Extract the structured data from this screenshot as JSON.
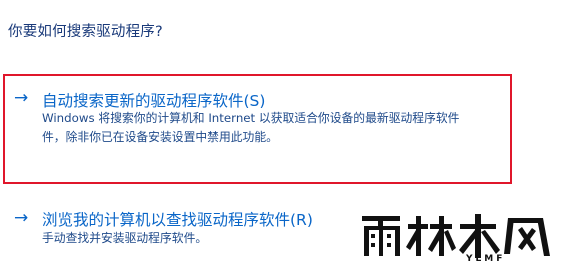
{
  "question": "你要如何搜索驱动程序?",
  "options": [
    {
      "arrow_icon": "arrow-right-icon",
      "title": "自动搜索更新的驱动程序软件(S)",
      "desc_line1": "Windows 将搜索你的计算机和 Internet 以获取适合你设备的最新驱动程序软件",
      "desc_line2": "件，除非你已在设备安装设置中禁用此功能。"
    },
    {
      "arrow_icon": "arrow-right-icon",
      "title": "浏览我的计算机以查找驱动程序软件(R)",
      "desc_line1": "手动查找并安装驱动程序软件。"
    }
  ],
  "highlight_color": "#e0162b",
  "accent_color": "#0a66c8",
  "watermark": {
    "text": "雨林木风",
    "sub": "YLMF"
  }
}
